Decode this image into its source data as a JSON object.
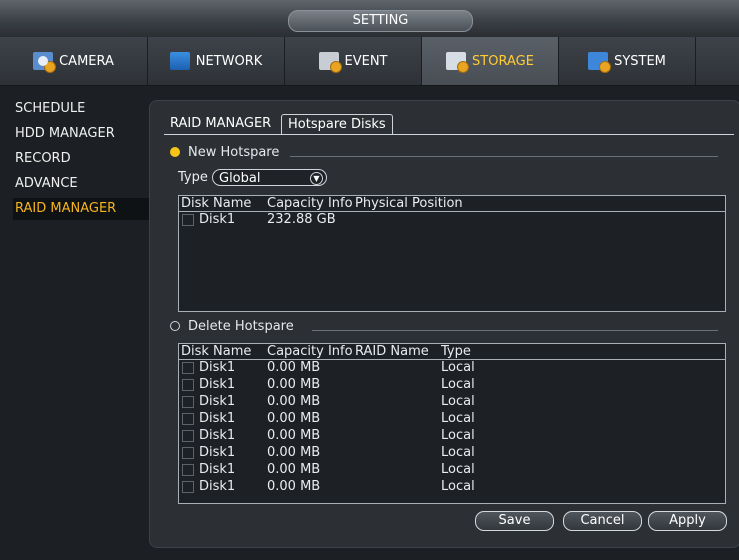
{
  "window": {
    "title": "SETTING"
  },
  "tabs": [
    {
      "label": "CAMERA",
      "icon": "camera-icon"
    },
    {
      "label": "NETWORK",
      "icon": "network-icon"
    },
    {
      "label": "EVENT",
      "icon": "event-icon"
    },
    {
      "label": "STORAGE",
      "icon": "storage-icon",
      "active": true
    },
    {
      "label": "SYSTEM",
      "icon": "system-icon"
    }
  ],
  "sidebar": {
    "items": [
      {
        "label": "SCHEDULE"
      },
      {
        "label": "HDD MANAGER"
      },
      {
        "label": "RECORD"
      },
      {
        "label": "ADVANCE"
      },
      {
        "label": "RAID MANAGER",
        "active": true
      }
    ]
  },
  "subtabs": [
    {
      "label": "RAID MANAGER"
    },
    {
      "label": "Hotspare Disks",
      "active": true
    }
  ],
  "new_hotspare": {
    "section_label": "New Hotspare",
    "type_label": "Type",
    "type_value": "Global",
    "columns": [
      "Disk Name",
      "Capacity Info",
      "Physical Position"
    ],
    "rows": [
      {
        "disk": "Disk1",
        "capacity": "232.88 GB",
        "position": ""
      }
    ]
  },
  "delete_hotspare": {
    "section_label": "Delete Hotspare",
    "columns": [
      "Disk Name",
      "Capacity Info",
      "RAID Name",
      "Type"
    ],
    "rows": [
      {
        "disk": "Disk1",
        "capacity": "0.00 MB",
        "raid": "",
        "type": "Local"
      },
      {
        "disk": "Disk1",
        "capacity": "0.00 MB",
        "raid": "",
        "type": "Local"
      },
      {
        "disk": "Disk1",
        "capacity": "0.00 MB",
        "raid": "",
        "type": "Local"
      },
      {
        "disk": "Disk1",
        "capacity": "0.00 MB",
        "raid": "",
        "type": "Local"
      },
      {
        "disk": "Disk1",
        "capacity": "0.00 MB",
        "raid": "",
        "type": "Local"
      },
      {
        "disk": "Disk1",
        "capacity": "0.00 MB",
        "raid": "",
        "type": "Local"
      },
      {
        "disk": "Disk1",
        "capacity": "0.00 MB",
        "raid": "",
        "type": "Local"
      },
      {
        "disk": "Disk1",
        "capacity": "0.00 MB",
        "raid": "",
        "type": "Local"
      }
    ]
  },
  "buttons": {
    "save": "Save",
    "cancel": "Cancel",
    "apply": "Apply"
  },
  "colors": {
    "accent": "#f6b41e",
    "active_radio": "#f5c518"
  }
}
